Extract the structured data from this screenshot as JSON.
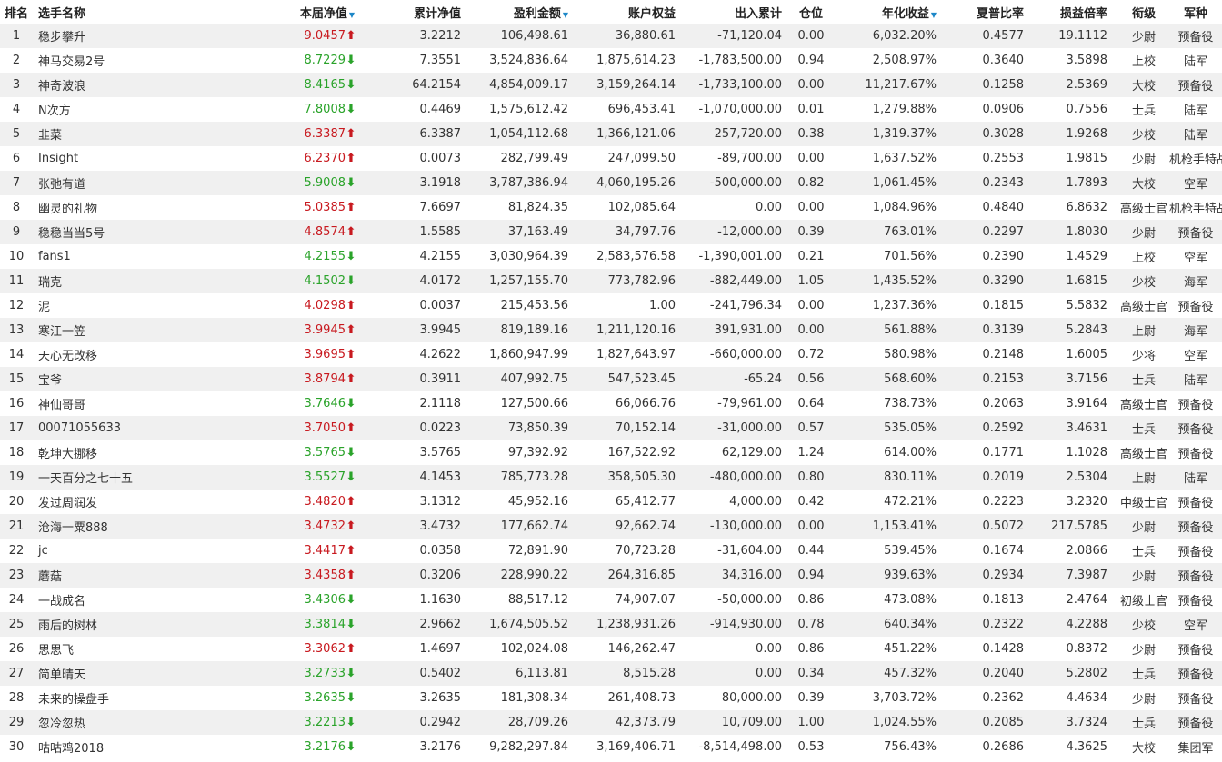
{
  "columns": {
    "rank": "排名",
    "name": "选手名称",
    "nav": "本届净值",
    "cum_nav": "累计净值",
    "profit": "盈利金额",
    "equity": "账户权益",
    "inout": "出入累计",
    "position": "仓位",
    "annual": "年化收益",
    "sharpe": "夏普比率",
    "pl_ratio": "损益倍率",
    "rank_title": "衔级",
    "branch": "军种"
  },
  "sort_icon": "▼",
  "colors": {
    "up": "#c8191f",
    "down": "#2aa32a",
    "sort": "#1e88c8"
  },
  "rows": [
    {
      "rank": "1",
      "name": "稳步攀升",
      "nav": "9.0457",
      "trend": "up",
      "cum_nav": "3.2212",
      "profit": "106,498.61",
      "equity": "36,880.61",
      "inout": "-71,120.04",
      "position": "0.00",
      "annual": "6,032.20%",
      "sharpe": "0.4577",
      "pl_ratio": "19.1112",
      "rank_title": "少尉",
      "branch": "预备役"
    },
    {
      "rank": "2",
      "name": "神马交易2号",
      "nav": "8.7229",
      "trend": "down",
      "cum_nav": "7.3551",
      "profit": "3,524,836.64",
      "equity": "1,875,614.23",
      "inout": "-1,783,500.00",
      "position": "0.94",
      "annual": "2,508.97%",
      "sharpe": "0.3640",
      "pl_ratio": "3.5898",
      "rank_title": "上校",
      "branch": "陆军"
    },
    {
      "rank": "3",
      "name": "神奇波浪",
      "nav": "8.4165",
      "trend": "down",
      "cum_nav": "64.2154",
      "profit": "4,854,009.17",
      "equity": "3,159,264.14",
      "inout": "-1,733,100.00",
      "position": "0.00",
      "annual": "11,217.67%",
      "sharpe": "0.1258",
      "pl_ratio": "2.5369",
      "rank_title": "大校",
      "branch": "预备役"
    },
    {
      "rank": "4",
      "name": "N次方",
      "nav": "7.8008",
      "trend": "down",
      "cum_nav": "0.4469",
      "profit": "1,575,612.42",
      "equity": "696,453.41",
      "inout": "-1,070,000.00",
      "position": "0.01",
      "annual": "1,279.88%",
      "sharpe": "0.0906",
      "pl_ratio": "0.7556",
      "rank_title": "士兵",
      "branch": "陆军"
    },
    {
      "rank": "5",
      "name": "韭菜",
      "nav": "6.3387",
      "trend": "up",
      "cum_nav": "6.3387",
      "profit": "1,054,112.68",
      "equity": "1,366,121.06",
      "inout": "257,720.00",
      "position": "0.38",
      "annual": "1,319.37%",
      "sharpe": "0.3028",
      "pl_ratio": "1.9268",
      "rank_title": "少校",
      "branch": "陆军"
    },
    {
      "rank": "6",
      "name": "Insight",
      "nav": "6.2370",
      "trend": "up",
      "cum_nav": "0.0073",
      "profit": "282,799.49",
      "equity": "247,099.50",
      "inout": "-89,700.00",
      "position": "0.00",
      "annual": "1,637.52%",
      "sharpe": "0.2553",
      "pl_ratio": "1.9815",
      "rank_title": "少尉",
      "branch": "机枪手特战营"
    },
    {
      "rank": "7",
      "name": "张弛有道",
      "nav": "5.9008",
      "trend": "down",
      "cum_nav": "3.1918",
      "profit": "3,787,386.94",
      "equity": "4,060,195.26",
      "inout": "-500,000.00",
      "position": "0.82",
      "annual": "1,061.45%",
      "sharpe": "0.2343",
      "pl_ratio": "1.7893",
      "rank_title": "大校",
      "branch": "空军"
    },
    {
      "rank": "8",
      "name": "幽灵的礼物",
      "nav": "5.0385",
      "trend": "up",
      "cum_nav": "7.6697",
      "profit": "81,824.35",
      "equity": "102,085.64",
      "inout": "0.00",
      "position": "0.00",
      "annual": "1,084.96%",
      "sharpe": "0.4840",
      "pl_ratio": "6.8632",
      "rank_title": "高级士官",
      "branch": "机枪手特战营"
    },
    {
      "rank": "9",
      "name": "稳稳当当5号",
      "nav": "4.8574",
      "trend": "up",
      "cum_nav": "1.5585",
      "profit": "37,163.49",
      "equity": "34,797.76",
      "inout": "-12,000.00",
      "position": "0.39",
      "annual": "763.01%",
      "sharpe": "0.2297",
      "pl_ratio": "1.8030",
      "rank_title": "少尉",
      "branch": "预备役"
    },
    {
      "rank": "10",
      "name": "fans1",
      "nav": "4.2155",
      "trend": "down",
      "cum_nav": "4.2155",
      "profit": "3,030,964.39",
      "equity": "2,583,576.58",
      "inout": "-1,390,001.00",
      "position": "0.21",
      "annual": "701.56%",
      "sharpe": "0.2390",
      "pl_ratio": "1.4529",
      "rank_title": "上校",
      "branch": "空军"
    },
    {
      "rank": "11",
      "name": "瑞克",
      "nav": "4.1502",
      "trend": "down",
      "cum_nav": "4.0172",
      "profit": "1,257,155.70",
      "equity": "773,782.96",
      "inout": "-882,449.00",
      "position": "1.05",
      "annual": "1,435.52%",
      "sharpe": "0.3290",
      "pl_ratio": "1.6815",
      "rank_title": "少校",
      "branch": "海军"
    },
    {
      "rank": "12",
      "name": "泥",
      "nav": "4.0298",
      "trend": "up",
      "cum_nav": "0.0037",
      "profit": "215,453.56",
      "equity": "1.00",
      "inout": "-241,796.34",
      "position": "0.00",
      "annual": "1,237.36%",
      "sharpe": "0.1815",
      "pl_ratio": "5.5832",
      "rank_title": "高级士官",
      "branch": "预备役"
    },
    {
      "rank": "13",
      "name": "寒江一笠",
      "nav": "3.9945",
      "trend": "up",
      "cum_nav": "3.9945",
      "profit": "819,189.16",
      "equity": "1,211,120.16",
      "inout": "391,931.00",
      "position": "0.00",
      "annual": "561.88%",
      "sharpe": "0.3139",
      "pl_ratio": "5.2843",
      "rank_title": "上尉",
      "branch": "海军"
    },
    {
      "rank": "14",
      "name": "天心无改移",
      "nav": "3.9695",
      "trend": "up",
      "cum_nav": "4.2622",
      "profit": "1,860,947.99",
      "equity": "1,827,643.97",
      "inout": "-660,000.00",
      "position": "0.72",
      "annual": "580.98%",
      "sharpe": "0.2148",
      "pl_ratio": "1.6005",
      "rank_title": "少将",
      "branch": "空军"
    },
    {
      "rank": "15",
      "name": "宝爷",
      "nav": "3.8794",
      "trend": "up",
      "cum_nav": "0.3911",
      "profit": "407,992.75",
      "equity": "547,523.45",
      "inout": "-65.24",
      "position": "0.56",
      "annual": "568.60%",
      "sharpe": "0.2153",
      "pl_ratio": "3.7156",
      "rank_title": "士兵",
      "branch": "陆军"
    },
    {
      "rank": "16",
      "name": "神仙哥哥",
      "nav": "3.7646",
      "trend": "down",
      "cum_nav": "2.1118",
      "profit": "127,500.66",
      "equity": "66,066.76",
      "inout": "-79,961.00",
      "position": "0.64",
      "annual": "738.73%",
      "sharpe": "0.2063",
      "pl_ratio": "3.9164",
      "rank_title": "高级士官",
      "branch": "预备役"
    },
    {
      "rank": "17",
      "name": "00071055633",
      "nav": "3.7050",
      "trend": "up",
      "cum_nav": "0.0223",
      "profit": "73,850.39",
      "equity": "70,152.14",
      "inout": "-31,000.00",
      "position": "0.57",
      "annual": "535.05%",
      "sharpe": "0.2592",
      "pl_ratio": "3.4631",
      "rank_title": "士兵",
      "branch": "预备役"
    },
    {
      "rank": "18",
      "name": "乾坤大挪移",
      "nav": "3.5765",
      "trend": "down",
      "cum_nav": "3.5765",
      "profit": "97,392.92",
      "equity": "167,522.92",
      "inout": "62,129.00",
      "position": "1.24",
      "annual": "614.00%",
      "sharpe": "0.1771",
      "pl_ratio": "1.1028",
      "rank_title": "高级士官",
      "branch": "预备役"
    },
    {
      "rank": "19",
      "name": "一天百分之七十五",
      "nav": "3.5527",
      "trend": "down",
      "cum_nav": "4.1453",
      "profit": "785,773.28",
      "equity": "358,505.30",
      "inout": "-480,000.00",
      "position": "0.80",
      "annual": "830.11%",
      "sharpe": "0.2019",
      "pl_ratio": "2.5304",
      "rank_title": "上尉",
      "branch": "陆军"
    },
    {
      "rank": "20",
      "name": "发过周润发",
      "nav": "3.4820",
      "trend": "up",
      "cum_nav": "3.1312",
      "profit": "45,952.16",
      "equity": "65,412.77",
      "inout": "4,000.00",
      "position": "0.42",
      "annual": "472.21%",
      "sharpe": "0.2223",
      "pl_ratio": "3.2320",
      "rank_title": "中级士官",
      "branch": "预备役"
    },
    {
      "rank": "21",
      "name": "沧海一粟888",
      "nav": "3.4732",
      "trend": "up",
      "cum_nav": "3.4732",
      "profit": "177,662.74",
      "equity": "92,662.74",
      "inout": "-130,000.00",
      "position": "0.00",
      "annual": "1,153.41%",
      "sharpe": "0.5072",
      "pl_ratio": "217.5785",
      "rank_title": "少尉",
      "branch": "预备役"
    },
    {
      "rank": "22",
      "name": "jc",
      "nav": "3.4417",
      "trend": "up",
      "cum_nav": "0.0358",
      "profit": "72,891.90",
      "equity": "70,723.28",
      "inout": "-31,604.00",
      "position": "0.44",
      "annual": "539.45%",
      "sharpe": "0.1674",
      "pl_ratio": "2.0866",
      "rank_title": "士兵",
      "branch": "预备役"
    },
    {
      "rank": "23",
      "name": "蘑菇",
      "nav": "3.4358",
      "trend": "up",
      "cum_nav": "0.3206",
      "profit": "228,990.22",
      "equity": "264,316.85",
      "inout": "34,316.00",
      "position": "0.94",
      "annual": "939.63%",
      "sharpe": "0.2934",
      "pl_ratio": "7.3987",
      "rank_title": "少尉",
      "branch": "预备役"
    },
    {
      "rank": "24",
      "name": "一战成名",
      "nav": "3.4306",
      "trend": "down",
      "cum_nav": "1.1630",
      "profit": "88,517.12",
      "equity": "74,907.07",
      "inout": "-50,000.00",
      "position": "0.86",
      "annual": "473.08%",
      "sharpe": "0.1813",
      "pl_ratio": "2.4764",
      "rank_title": "初级士官",
      "branch": "预备役"
    },
    {
      "rank": "25",
      "name": "雨后的树林",
      "nav": "3.3814",
      "trend": "down",
      "cum_nav": "2.9662",
      "profit": "1,674,505.52",
      "equity": "1,238,931.26",
      "inout": "-914,930.00",
      "position": "0.78",
      "annual": "640.34%",
      "sharpe": "0.2322",
      "pl_ratio": "4.2288",
      "rank_title": "少校",
      "branch": "空军"
    },
    {
      "rank": "26",
      "name": "思思飞",
      "nav": "3.3062",
      "trend": "up",
      "cum_nav": "1.4697",
      "profit": "102,024.08",
      "equity": "146,262.47",
      "inout": "0.00",
      "position": "0.86",
      "annual": "451.22%",
      "sharpe": "0.1428",
      "pl_ratio": "0.8372",
      "rank_title": "少尉",
      "branch": "预备役"
    },
    {
      "rank": "27",
      "name": "简单晴天",
      "nav": "3.2733",
      "trend": "down",
      "cum_nav": "0.5402",
      "profit": "6,113.81",
      "equity": "8,515.28",
      "inout": "0.00",
      "position": "0.34",
      "annual": "457.32%",
      "sharpe": "0.2040",
      "pl_ratio": "5.2802",
      "rank_title": "士兵",
      "branch": "预备役"
    },
    {
      "rank": "28",
      "name": "未来的操盘手",
      "nav": "3.2635",
      "trend": "down",
      "cum_nav": "3.2635",
      "profit": "181,308.34",
      "equity": "261,408.73",
      "inout": "80,000.00",
      "position": "0.39",
      "annual": "3,703.72%",
      "sharpe": "0.2362",
      "pl_ratio": "4.4634",
      "rank_title": "少尉",
      "branch": "预备役"
    },
    {
      "rank": "29",
      "name": "忽冷忽热",
      "nav": "3.2213",
      "trend": "down",
      "cum_nav": "0.2942",
      "profit": "28,709.26",
      "equity": "42,373.79",
      "inout": "10,709.00",
      "position": "1.00",
      "annual": "1,024.55%",
      "sharpe": "0.2085",
      "pl_ratio": "3.7324",
      "rank_title": "士兵",
      "branch": "预备役"
    },
    {
      "rank": "30",
      "name": "咕咕鸡2018",
      "nav": "3.2176",
      "trend": "down",
      "cum_nav": "3.2176",
      "profit": "9,282,297.84",
      "equity": "3,169,406.71",
      "inout": "-8,514,498.00",
      "position": "0.53",
      "annual": "756.43%",
      "sharpe": "0.2686",
      "pl_ratio": "4.3625",
      "rank_title": "大校",
      "branch": "集团军"
    }
  ]
}
